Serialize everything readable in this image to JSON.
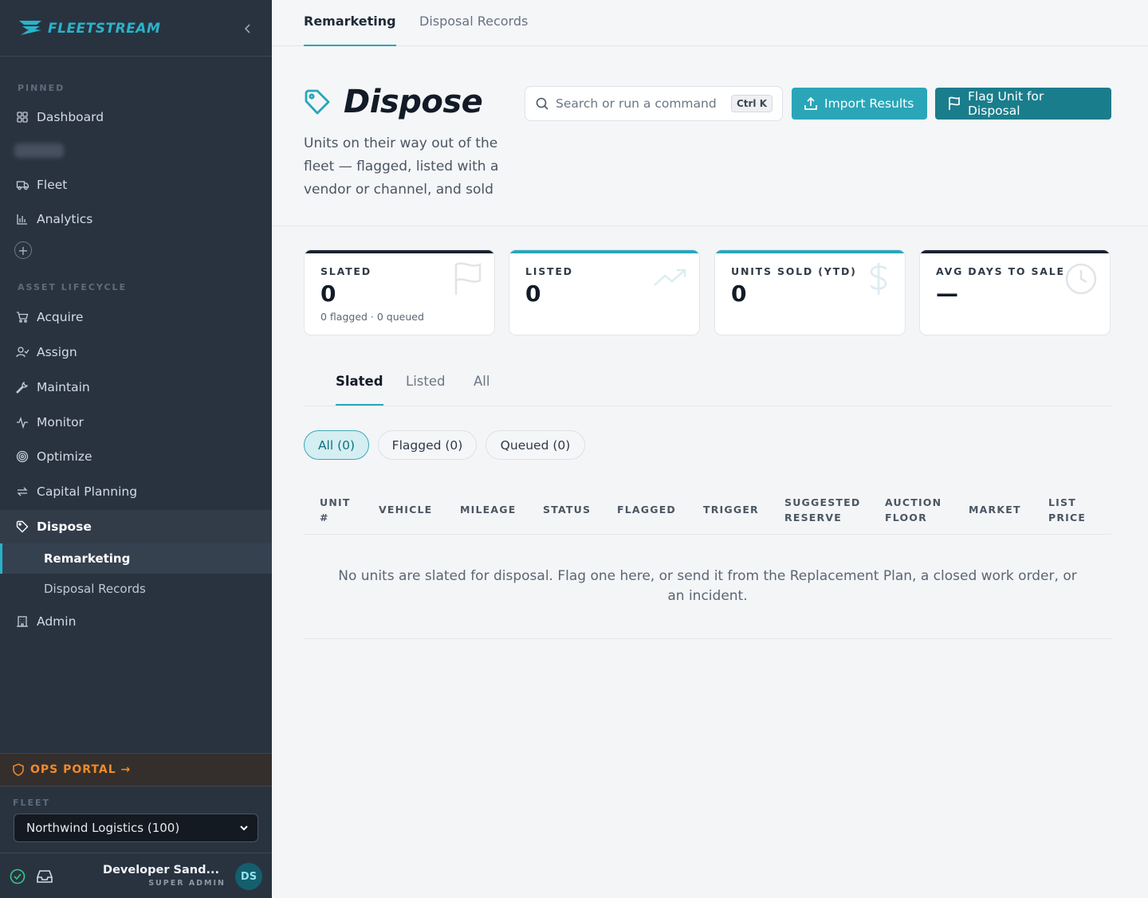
{
  "brand": {
    "name": "FLEETSTREAM"
  },
  "sidebar": {
    "pinned_label": "PINNED",
    "pinned": [
      {
        "label": "Dashboard",
        "icon": "grid-icon"
      },
      {
        "label": "Fleet",
        "icon": "truck-icon"
      },
      {
        "label": "Analytics",
        "icon": "bar-chart-icon"
      }
    ],
    "lifecycle_label": "ASSET LIFECYCLE",
    "lifecycle": [
      {
        "label": "Acquire",
        "icon": "cart-icon"
      },
      {
        "label": "Assign",
        "icon": "user-check-icon"
      },
      {
        "label": "Maintain",
        "icon": "wrench-icon"
      },
      {
        "label": "Monitor",
        "icon": "pulse-icon"
      },
      {
        "label": "Optimize",
        "icon": "target-icon"
      },
      {
        "label": "Capital Planning",
        "icon": "cycle-icon"
      },
      {
        "label": "Dispose",
        "icon": "tag-icon"
      }
    ],
    "dispose_children": [
      {
        "label": "Remarketing"
      },
      {
        "label": "Disposal Records"
      }
    ],
    "admin": {
      "label": "Admin",
      "icon": "building-icon"
    },
    "ops_portal": "OPS PORTAL →",
    "fleet_label": "FLEET",
    "fleet_selected": "Northwind Logistics (100)",
    "user": {
      "name": "Developer Sand...",
      "role": "SUPER ADMIN",
      "initials": "DS"
    }
  },
  "top_tabs": [
    {
      "label": "Remarketing"
    },
    {
      "label": "Disposal Records"
    }
  ],
  "header": {
    "title": "Dispose",
    "description": "Units on their way out of the fleet — flagged, listed with a vendor or channel, and sold",
    "search_placeholder": "Search or run a command",
    "search_shortcut": "Ctrl K",
    "import_label": "Import Results",
    "flag_label": "Flag Unit for Disposal"
  },
  "stats": [
    {
      "label": "SLATED",
      "value": "0",
      "sub": "0 flagged · 0 queued",
      "accent": "#1a2230",
      "icon": "flag-icon"
    },
    {
      "label": "LISTED",
      "value": "0",
      "sub": "",
      "accent": "#2aa6b8",
      "icon": "trend-up-icon"
    },
    {
      "label": "UNITS SOLD (YTD)",
      "value": "0",
      "sub": "",
      "accent": "#2aa6b8",
      "icon": "dollar-icon"
    },
    {
      "label": "AVG DAYS TO SALE",
      "value": "—",
      "sub": "",
      "accent": "#1a2230",
      "icon": "clock-icon"
    }
  ],
  "sub_tabs": [
    {
      "label": "Slated"
    },
    {
      "label": "Listed"
    },
    {
      "label": "All"
    }
  ],
  "chips": [
    {
      "label": "All (0)"
    },
    {
      "label": "Flagged (0)"
    },
    {
      "label": "Queued (0)"
    }
  ],
  "table": {
    "columns": [
      [
        "UNIT",
        "#"
      ],
      [
        "VEHICLE"
      ],
      [
        "MILEAGE"
      ],
      [
        "STATUS"
      ],
      [
        "FLAGGED"
      ],
      [
        "TRIGGER"
      ],
      [
        "SUGGESTED",
        "RESERVE"
      ],
      [
        "AUCTION",
        "FLOOR"
      ],
      [
        "MARKET"
      ],
      [
        "LIST",
        "PRICE"
      ]
    ],
    "empty_message": "No units are slated for disposal. Flag one here, or send it from the Replacement Plan, a closed work order, or an incident."
  },
  "colors": {
    "accent": "#2aa6b8",
    "accent_dark": "#1a7d8c",
    "sidebar": "#293340",
    "ops": "#f08a2c"
  }
}
